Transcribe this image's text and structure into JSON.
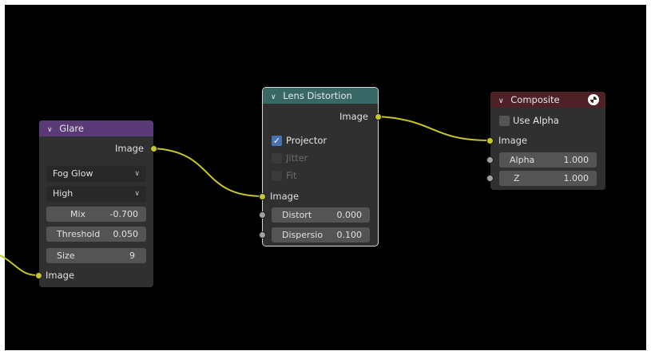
{
  "nodes": {
    "glare": {
      "title": "Glare",
      "header_color": "#5a3977",
      "output_label": "Image",
      "glare_type": "Fog Glow",
      "quality": "High",
      "mix": {
        "label": "Mix",
        "value": "-0.700"
      },
      "threshold": {
        "label": "Threshold",
        "value": "0.050"
      },
      "size": {
        "label": "Size",
        "value": "9"
      },
      "input_label": "Image"
    },
    "lens_distortion": {
      "title": "Lens Distortion",
      "header_color": "#386866",
      "output_label": "Image",
      "projector": {
        "label": "Projector",
        "checked": true
      },
      "jitter": {
        "label": "Jitter",
        "checked": false,
        "enabled": false
      },
      "fit": {
        "label": "Fit",
        "checked": false,
        "enabled": false
      },
      "input_label": "Image",
      "distort": {
        "label": "Distort",
        "value": "0.000"
      },
      "dispersion": {
        "label": "Dispersio",
        "value": "0.100"
      }
    },
    "composite": {
      "title": "Composite",
      "header_color": "#4d2126",
      "use_alpha": {
        "label": "Use Alpha",
        "checked": false
      },
      "input_label": "Image",
      "alpha": {
        "label": "Alpha",
        "value": "1.000"
      },
      "z": {
        "label": "Z",
        "value": "1.000"
      }
    }
  },
  "colors": {
    "canvas_bg": "#000000",
    "node_body": "#303030",
    "wire": "#c7c729",
    "image_socket": "#c7c729",
    "value_socket": "#a1a1a1",
    "checkbox_on": "#4772b3"
  },
  "icons": {
    "collapse": "chevron-down-icon",
    "composite_render": "render-result-icon",
    "check": "check-icon"
  }
}
